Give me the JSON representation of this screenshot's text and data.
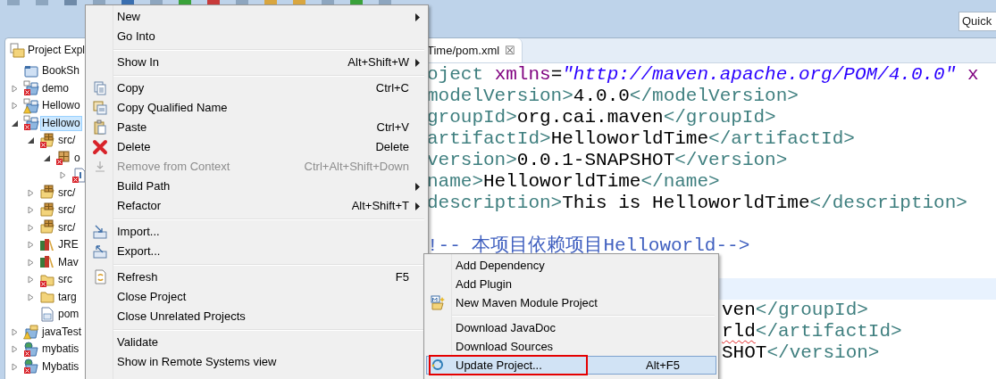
{
  "quick_access": {
    "placeholder": "Quick"
  },
  "project_explorer": {
    "title": "Project Expl",
    "tree": [
      {
        "label": "BookSh",
        "kind": "closed-project",
        "selected": false
      },
      {
        "label": "demo",
        "kind": "maven-project",
        "errors": true,
        "expanded": false,
        "selected": false
      },
      {
        "label": "Hellowo",
        "kind": "maven-project",
        "warnings": true,
        "expanded": false,
        "selected": false
      },
      {
        "label": "Hellowo",
        "kind": "maven-project",
        "errors": true,
        "expanded": true,
        "selected": true,
        "children": [
          {
            "label": "src/",
            "kind": "source-folder",
            "errors": true,
            "expanded": true,
            "selected": false,
            "children": [
              {
                "label": "o",
                "kind": "package",
                "errors": true,
                "expanded": true,
                "selected": false,
                "children": [
                  {
                    "kind": "java-file",
                    "errors": true,
                    "expanded": false
                  }
                ]
              }
            ]
          },
          {
            "label": "src/",
            "kind": "source-folder",
            "expanded": false,
            "selected": false
          },
          {
            "label": "src/",
            "kind": "source-folder",
            "expanded": false,
            "selected": false
          },
          {
            "label": "src/",
            "kind": "source-folder",
            "expanded": false,
            "selected": false
          },
          {
            "label": "JRE",
            "kind": "library",
            "expanded": false,
            "selected": false
          },
          {
            "label": "Mav",
            "kind": "library",
            "expanded": false,
            "selected": false
          },
          {
            "label": "src",
            "kind": "folder",
            "errors": true,
            "expanded": false,
            "selected": false
          },
          {
            "label": "targ",
            "kind": "folder",
            "expanded": false,
            "selected": false
          },
          {
            "label": "pom",
            "kind": "pom-file",
            "selected": false
          }
        ]
      },
      {
        "label": "javaTest",
        "kind": "java-project",
        "warnings": true,
        "expanded": false,
        "selected": false
      },
      {
        "label": "mybatis",
        "kind": "web-project",
        "errors": true,
        "expanded": false,
        "selected": false
      },
      {
        "label": "Mybatis",
        "kind": "web-project",
        "errors": true,
        "expanded": false,
        "selected": false
      }
    ]
  },
  "editor": {
    "tab": {
      "title": "Time/pom.xml",
      "close": "☒"
    },
    "lines": [
      {
        "current": false,
        "segments": [
          {
            "kind": "tag",
            "text": "oject "
          },
          {
            "kind": "attr",
            "text": "xmlns"
          },
          {
            "kind": "plain",
            "text": "="
          },
          {
            "kind": "string",
            "text": "\"http://maven.apache.org/POM/4.0.0\""
          },
          {
            "kind": "attr",
            "text": " x"
          }
        ]
      },
      {
        "current": false,
        "segments": [
          {
            "kind": "tag",
            "text": "modelVersion>"
          },
          {
            "kind": "plain",
            "text": "4.0.0"
          },
          {
            "kind": "tag",
            "text": "</modelVersion>"
          }
        ]
      },
      {
        "current": false,
        "segments": [
          {
            "kind": "tag",
            "text": "groupId>"
          },
          {
            "kind": "plain",
            "text": "org.cai.maven"
          },
          {
            "kind": "tag",
            "text": "</groupId>"
          }
        ]
      },
      {
        "current": false,
        "segments": [
          {
            "kind": "tag",
            "text": "artifactId>"
          },
          {
            "kind": "plain",
            "text": "HelloworldTime"
          },
          {
            "kind": "tag",
            "text": "</artifactId>"
          }
        ]
      },
      {
        "current": false,
        "segments": [
          {
            "kind": "tag",
            "text": "version>"
          },
          {
            "kind": "plain",
            "text": "0.0.1-SNAPSHOT"
          },
          {
            "kind": "tag",
            "text": "</version>"
          }
        ]
      },
      {
        "current": false,
        "segments": [
          {
            "kind": "tag",
            "text": "name>"
          },
          {
            "kind": "plain",
            "text": "HelloworldTime"
          },
          {
            "kind": "tag",
            "text": "</name>"
          }
        ]
      },
      {
        "current": false,
        "segments": [
          {
            "kind": "tag",
            "text": "description>"
          },
          {
            "kind": "plain",
            "text": "This is HelloworldTime"
          },
          {
            "kind": "tag",
            "text": "</description>"
          }
        ]
      },
      {
        "current": false
      },
      {
        "current": false,
        "segments": [
          {
            "kind": "comment",
            "text": "!-- 本项目依赖项目Helloworld-->"
          }
        ]
      },
      {
        "current": false
      },
      {
        "current": true
      },
      {
        "current": false,
        "tail": true,
        "segments": [
          {
            "kind": "plain",
            "text": "ven"
          },
          {
            "kind": "tag",
            "text": "</groupId>"
          }
        ]
      },
      {
        "current": false,
        "tail": true,
        "segments": [
          {
            "kind": "plain",
            "text": "rld",
            "misspelled": true
          },
          {
            "kind": "tag",
            "text": "</artifactId>"
          }
        ]
      },
      {
        "current": false,
        "tail": true,
        "segments": [
          {
            "kind": "plain",
            "text": "SHOT"
          },
          {
            "kind": "tag",
            "text": "</version>"
          }
        ]
      }
    ]
  },
  "context_menu": {
    "items": [
      {
        "kind": "item",
        "label": "New",
        "submenu": true,
        "disabled": false
      },
      {
        "kind": "item",
        "label": "Go Into",
        "disabled": false
      },
      {
        "kind": "separator"
      },
      {
        "kind": "item",
        "label": "Show In",
        "shortcut": "Alt+Shift+W",
        "submenu": true,
        "disabled": false
      },
      {
        "kind": "separator"
      },
      {
        "kind": "item",
        "label": "Copy",
        "shortcut": "Ctrl+C",
        "disabled": false
      },
      {
        "kind": "item",
        "label": "Copy Qualified Name",
        "disabled": false
      },
      {
        "kind": "item",
        "label": "Paste",
        "shortcut": "Ctrl+V",
        "disabled": false
      },
      {
        "kind": "item",
        "label": "Delete",
        "shortcut": "Delete",
        "disabled": false
      },
      {
        "kind": "item",
        "label": "Remove from Context",
        "shortcut": "Ctrl+Alt+Shift+Down",
        "disabled": true
      },
      {
        "kind": "item",
        "label": "Build Path",
        "submenu": true,
        "disabled": false
      },
      {
        "kind": "item",
        "label": "Refactor",
        "shortcut": "Alt+Shift+T",
        "submenu": true,
        "disabled": false
      },
      {
        "kind": "separator"
      },
      {
        "kind": "item",
        "label": "Import...",
        "disabled": false
      },
      {
        "kind": "item",
        "label": "Export...",
        "disabled": false
      },
      {
        "kind": "separator"
      },
      {
        "kind": "item",
        "label": "Refresh",
        "shortcut": "F5",
        "disabled": false
      },
      {
        "kind": "item",
        "label": "Close Project",
        "disabled": false
      },
      {
        "kind": "item",
        "label": "Close Unrelated Projects",
        "disabled": false
      },
      {
        "kind": "separator"
      },
      {
        "kind": "item",
        "label": "Validate",
        "disabled": false
      },
      {
        "kind": "item",
        "label": "Show in Remote Systems view",
        "disabled": false
      }
    ]
  },
  "maven_submenu": {
    "items": [
      {
        "kind": "item",
        "label": "Add Dependency",
        "selected": false
      },
      {
        "kind": "item",
        "label": "Add Plugin",
        "selected": false
      },
      {
        "kind": "item",
        "label": "New Maven Module Project",
        "selected": false
      },
      {
        "kind": "separator"
      },
      {
        "kind": "item",
        "label": "Download JavaDoc",
        "selected": false
      },
      {
        "kind": "item",
        "label": "Download Sources",
        "selected": false
      },
      {
        "kind": "item",
        "label": "Update Project...",
        "shortcut": "Alt+F5",
        "selected": true,
        "annotated": true
      }
    ]
  }
}
